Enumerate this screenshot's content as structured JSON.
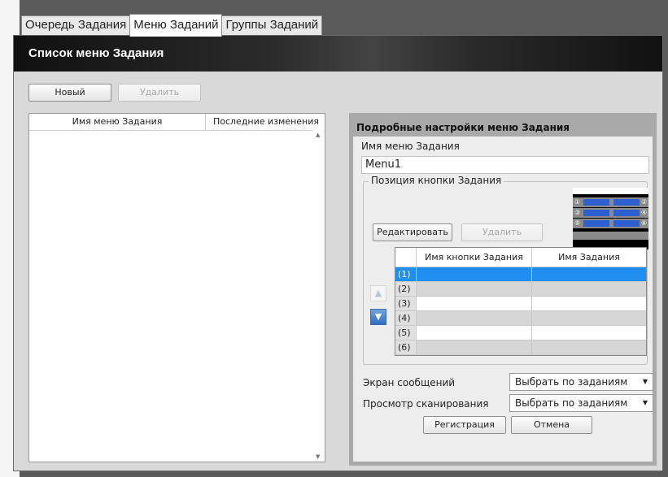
{
  "tabs": [
    "Очередь Задания",
    "Меню Заданий",
    "Группы Заданий"
  ],
  "header": {
    "title": "Список меню Задания"
  },
  "toolbar": {
    "new_label": "Новый",
    "delete_label": "Удалить"
  },
  "menu_list": {
    "columns": [
      "Имя меню Задания",
      "Последние изменения"
    ],
    "rows": []
  },
  "details": {
    "title": "Подробные настройки меню Задания",
    "menu_name_label": "Имя меню Задания",
    "menu_name_value": "Menu1",
    "position_group_label": "Позиция кнопки Задания",
    "edit_label": "Редактировать",
    "delete_label": "Удалить",
    "preview_numbers": [
      "①",
      "②",
      "③",
      "④",
      "⑤",
      "⑥"
    ],
    "grid_columns": [
      "Имя кнопки Задания",
      "Имя Задания"
    ],
    "grid_rows": [
      {
        "num": "(1)",
        "button": "",
        "job": ""
      },
      {
        "num": "(2)",
        "button": "",
        "job": ""
      },
      {
        "num": "(3)",
        "button": "",
        "job": ""
      },
      {
        "num": "(4)",
        "button": "",
        "job": ""
      },
      {
        "num": "(5)",
        "button": "",
        "job": ""
      },
      {
        "num": "(6)",
        "button": "",
        "job": ""
      }
    ],
    "selected_row": 0,
    "message_screen_label": "Экран сообщений",
    "message_screen_value": "Выбрать по заданиям",
    "scan_view_label": "Просмотр сканирования",
    "scan_view_value": "Выбрать по заданиям",
    "register_label": "Регистрация",
    "cancel_label": "Отмена"
  },
  "colors": {
    "selection": "#1e8ff0",
    "preview_button": "#2e5fd1",
    "header_bg": "#1a1a1a"
  }
}
